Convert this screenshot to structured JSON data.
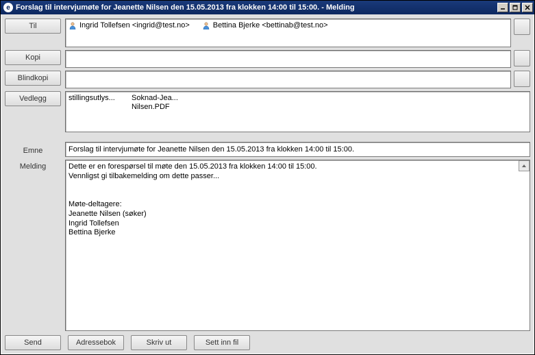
{
  "window": {
    "title": "Forslag til intervjumøte for Jeanette Nilsen den 15.05.2013 fra klokken 14:00 til 15:00. - Melding"
  },
  "labels": {
    "to": "Til",
    "cc": "Kopi",
    "bcc": "Blindkopi",
    "attachments": "Vedlegg",
    "subject": "Emne",
    "message": "Melding"
  },
  "recipients": {
    "to": [
      {
        "display": "Ingrid Tollefsen <ingrid@test.no>"
      },
      {
        "display": "Bettina Bjerke <bettinab@test.no>"
      }
    ]
  },
  "attachments": [
    {
      "name": "stillingsutlys..."
    },
    {
      "name": "Soknad-Jea...\nNilsen.PDF"
    }
  ],
  "subject": "Forslag til intervjumøte for Jeanette Nilsen den 15.05.2013 fra klokken 14:00 til 15:00.",
  "body": "Dette er en forespørsel til møte den 15.05.2013 fra klokken 14:00 til 15:00.\nVennligst gi tilbakemelding om dette passer...\n\n\nMøte-deltagere:\nJeanette Nilsen (søker)\nIngrid Tollefsen\nBettina Bjerke",
  "buttons": {
    "send": "Send",
    "addressbook": "Adressebok",
    "print": "Skriv ut",
    "insert_file": "Sett inn fil"
  }
}
